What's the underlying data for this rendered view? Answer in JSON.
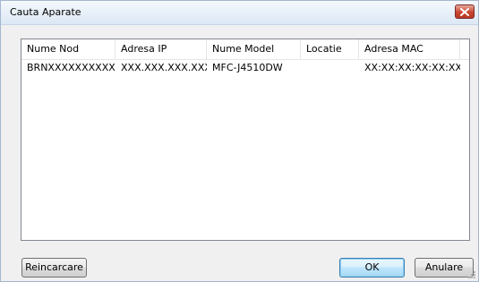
{
  "window": {
    "title": "Cauta Aparate"
  },
  "table": {
    "columns": [
      "Nume Nod",
      "Adresa IP",
      "Nume Model",
      "Locatie",
      "Adresa MAC"
    ],
    "rows": [
      [
        "BRNXXXXXXXXXXXX",
        "XXX.XXX.XXX.XXX",
        "MFC-J4510DW",
        "",
        "XX:XX:XX:XX:XX:XX"
      ]
    ]
  },
  "buttons": {
    "reload_label": "Reincarcare",
    "ok_label": "OK",
    "cancel_label": "Anulare"
  },
  "colors": {
    "close_button": "#c8452e",
    "default_button_border": "#3c7fb1"
  },
  "icons": {
    "close": "close-icon",
    "resize": "resize-grip-icon"
  }
}
